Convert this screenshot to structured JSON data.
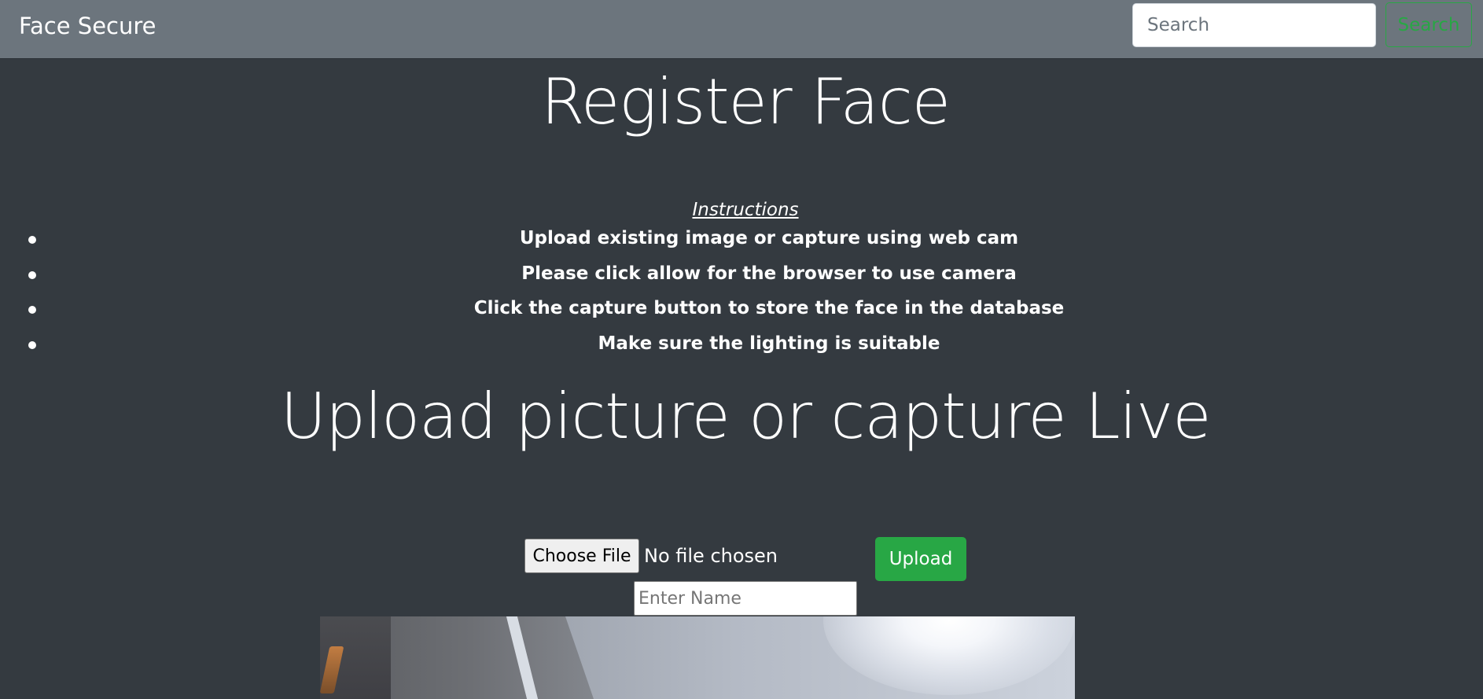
{
  "navbar": {
    "brand": "Face Secure",
    "search_placeholder": "Search",
    "search_button_label": "Search"
  },
  "main": {
    "title": "Register Face",
    "instructions_heading": "Instructions",
    "instructions": [
      "Upload existing image or capture using web cam",
      "Please click allow for the browser to use camera",
      "Click the capture button to store the face in the database",
      "Make sure the lighting is suitable"
    ],
    "subtitle": "Upload picture or capture Live"
  },
  "upload_form": {
    "choose_file_label": "Choose File",
    "file_status": "No file chosen",
    "upload_button_label": "Upload",
    "name_placeholder": "Enter Name"
  },
  "colors": {
    "page_background": "#343a40",
    "navbar_background": "#6c757d",
    "accent_green": "#28a745"
  }
}
